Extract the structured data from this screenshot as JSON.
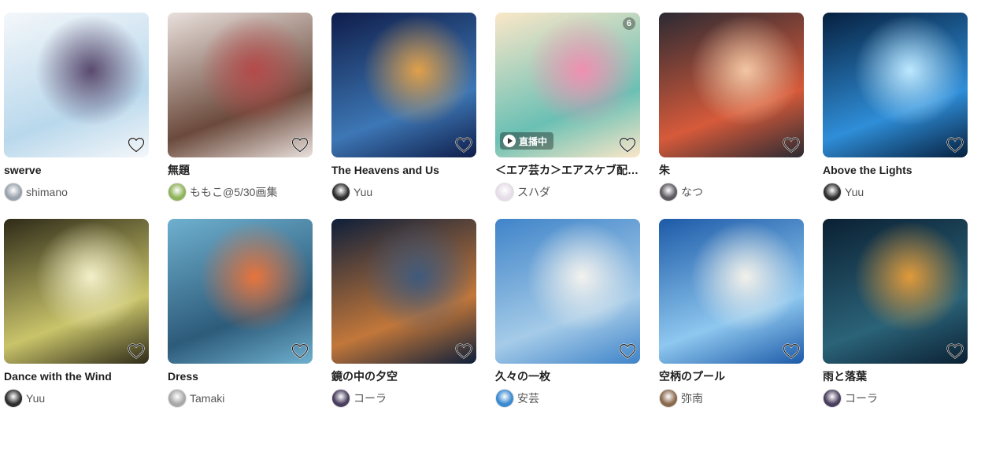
{
  "artworks": [
    {
      "title": "swerve",
      "author": "shimano",
      "art_colors": [
        "#f4f7fa",
        "#b9d8ec",
        "#5a4a6e"
      ],
      "avatar_color": "#9aa3ad",
      "badge": null,
      "live": null
    },
    {
      "title": "無題",
      "author": "ももこ@5/30画集",
      "art_colors": [
        "#e9e0dc",
        "#6b4a3c",
        "#b44a4a"
      ],
      "avatar_color": "#8fb35a",
      "badge": null,
      "live": null
    },
    {
      "title": "The Heavens and Us",
      "author": "Yuu",
      "art_colors": [
        "#0f1d4a",
        "#3d77b5",
        "#e0a04a"
      ],
      "avatar_color": "#2e2e2e",
      "badge": null,
      "live": null
    },
    {
      "title": "＜エア芸カ＞エアスケブ配信中！",
      "author": "スハダ",
      "art_colors": [
        "#fbe7c8",
        "#6ac0b4",
        "#f08fb0"
      ],
      "avatar_color": "#e6dde8",
      "badge": "6",
      "live": "直播中"
    },
    {
      "title": "朱",
      "author": "なつ",
      "art_colors": [
        "#2b2a33",
        "#d65a3a",
        "#f2c6a4"
      ],
      "avatar_color": "#5e5a62",
      "badge": null,
      "live": null
    },
    {
      "title": "Above the Lights",
      "author": "Yuu",
      "art_colors": [
        "#06203f",
        "#2f8ed8",
        "#bde8ff"
      ],
      "avatar_color": "#2e2e2e",
      "badge": null,
      "live": null
    },
    {
      "title": "Dance with the Wind",
      "author": "Yuu",
      "art_colors": [
        "#2e2a18",
        "#c9c46a",
        "#f3efc9"
      ],
      "avatar_color": "#2e2e2e",
      "badge": null,
      "live": null
    },
    {
      "title": "Dress",
      "author": "Tamaki",
      "art_colors": [
        "#6fb0cf",
        "#2d5b7a",
        "#e7743d"
      ],
      "avatar_color": "#a8a8a8",
      "badge": null,
      "live": null
    },
    {
      "title": "鏡の中の夕空",
      "author": "コーラ",
      "art_colors": [
        "#0e1f3a",
        "#c2773a",
        "#3f5a7c"
      ],
      "avatar_color": "#4a3e5e",
      "badge": null,
      "live": null
    },
    {
      "title": "久々の一枚",
      "author": "安芸",
      "art_colors": [
        "#3f84c9",
        "#a5cbe8",
        "#f3f2ee"
      ],
      "avatar_color": "#3a8ad1",
      "badge": null,
      "live": null
    },
    {
      "title": "空柄のプール",
      "author": "弥南",
      "art_colors": [
        "#1c5aa8",
        "#8ec7ef",
        "#f3f1ea"
      ],
      "avatar_color": "#8a6a4e",
      "badge": null,
      "live": null
    },
    {
      "title": "雨と落葉",
      "author": "コーラ",
      "art_colors": [
        "#0b2033",
        "#2b6378",
        "#e09a3a"
      ],
      "avatar_color": "#4a3e5e",
      "badge": null,
      "live": null
    }
  ],
  "icons": {
    "bookmark": "heart-outline-icon",
    "live": "play-circle-icon"
  }
}
